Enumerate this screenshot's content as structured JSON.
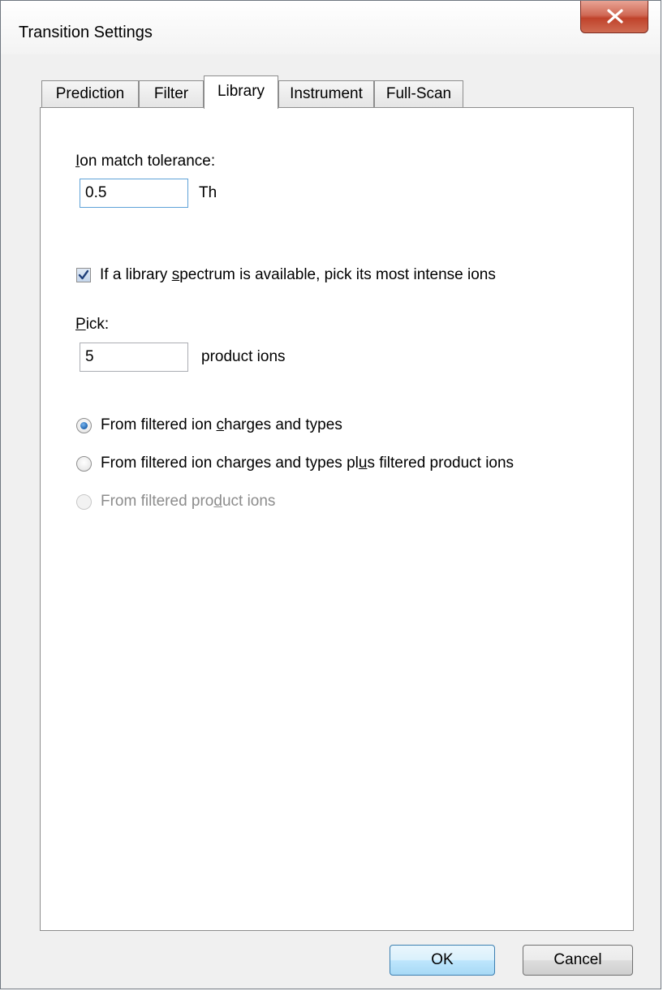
{
  "window": {
    "title": "Transition Settings"
  },
  "tabs": [
    {
      "label": "Prediction",
      "active": false
    },
    {
      "label": "Filter",
      "active": false
    },
    {
      "label": "Library",
      "active": true
    },
    {
      "label": "Instrument",
      "active": false
    },
    {
      "label": "Full-Scan",
      "active": false
    }
  ],
  "library": {
    "ion_match_tolerance": {
      "label_mnemonic": "I",
      "label_rest": "on match tolerance:",
      "value": "0.5",
      "unit": "Th"
    },
    "pick_intense_checkbox": {
      "checked": true,
      "label_pre": "If a library ",
      "label_mnemonic": "s",
      "label_post": "pectrum is available, pick its most intense ions"
    },
    "pick": {
      "label_mnemonic": "P",
      "label_rest": "ick:",
      "value": "5",
      "unit": "product ions"
    },
    "radio_options": {
      "charges_types": {
        "selected": true,
        "label_pre": "From filtered ion ",
        "label_mnemonic": "c",
        "label_post": "harges and types"
      },
      "charges_types_plus_product": {
        "selected": false,
        "label_pre": "From filtered ion charges and types pl",
        "label_mnemonic": "u",
        "label_post": "s filtered product ions"
      },
      "product_ions": {
        "selected": false,
        "enabled": false,
        "label_pre": "From filtered pro",
        "label_mnemonic": "d",
        "label_post": "uct ions"
      }
    }
  },
  "buttons": {
    "ok": "OK",
    "cancel": "Cancel"
  },
  "colors": {
    "accent": "#3c7fb1",
    "close_button": "#c0432b",
    "disabled_text": "#8c8c8c"
  }
}
